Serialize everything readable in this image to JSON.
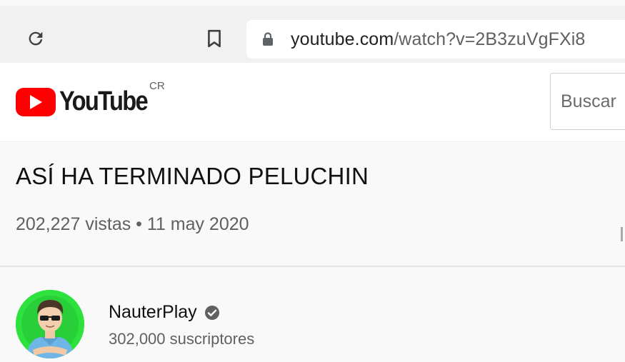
{
  "browser": {
    "url_domain": "youtube.com",
    "url_path": "/watch?v=2B3zuVgFXi8"
  },
  "header": {
    "logo_text": "YouTube",
    "country_code": "CR",
    "search_placeholder": "Buscar"
  },
  "video": {
    "title": "ASÍ HA TERMINADO PELUCHIN",
    "meta": "202,227 vistas • 11 may 2020"
  },
  "channel": {
    "name": "NauterPlay",
    "subscribers": "302,000 suscriptores"
  },
  "colors": {
    "brand_red": "#ff0000",
    "avatar_bg": "#2ee23e"
  },
  "icons": {
    "reload": "reload-icon",
    "bookmark": "bookmark-icon",
    "lock": "lock-icon",
    "play": "youtube-play-icon",
    "verified": "verified-check-icon"
  }
}
